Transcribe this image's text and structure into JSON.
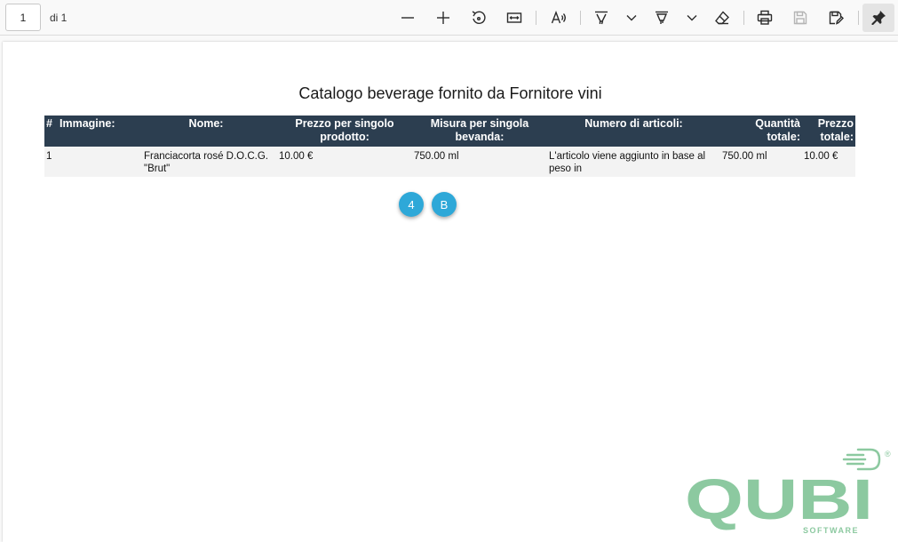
{
  "toolbar": {
    "page_number": "1",
    "page_of": "di 1",
    "icons": {
      "zoom_out": "minus-icon",
      "zoom_in": "plus-icon",
      "rotate": "rotate-icon",
      "fit_width": "fit-width-icon",
      "read_aloud": "read-aloud-icon",
      "draw": "draw-icon",
      "highlight": "highlight-icon",
      "erase": "eraser-icon",
      "print": "print-icon",
      "save": "save-icon",
      "save_as": "save-as-icon",
      "pin": "pin-icon"
    }
  },
  "document": {
    "title": "Catalogo beverage fornito da Fornitore vini",
    "table": {
      "headers": [
        "#",
        "Immagine:",
        "Nome:",
        "Prezzo per singolo prodotto:",
        "Misura per singola bevanda:",
        "Numero di articoli:",
        "Quantità totale:",
        "Prezzo totale:"
      ],
      "rows": [
        [
          "1",
          "",
          "Franciacorta rosé D.O.C.G. \"Brut\"",
          "10.00 €",
          "750.00 ml",
          "L'articolo viene aggiunto in base al peso in",
          "750.00 ml",
          "10.00 €"
        ]
      ]
    },
    "buttons": {
      "first": "4",
      "second": "B"
    },
    "logo": {
      "text": "QUBI",
      "subtext": "SOFTWARE",
      "mark": "®",
      "color": "#8cc9a0"
    }
  },
  "colors": {
    "header_bg": "#2c3e50",
    "row_bg": "#f3f3f3",
    "pill_bg": "#2ea8d8"
  }
}
